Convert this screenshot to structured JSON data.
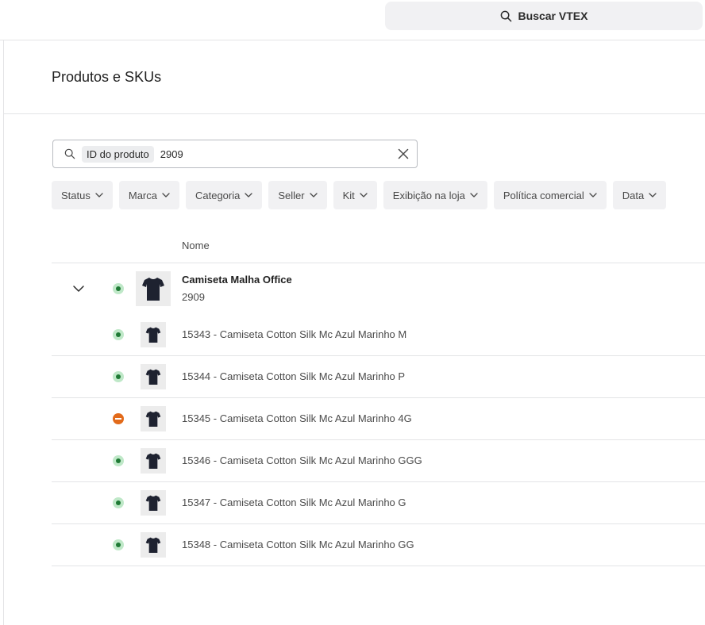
{
  "topbar": {
    "search_label": "Buscar VTEX",
    "search_icon": "search-icon"
  },
  "page": {
    "title": "Produtos e SKUs"
  },
  "filter_input": {
    "chip_label": "ID do produto",
    "value": "2909",
    "clear_icon": "close-icon"
  },
  "filters": [
    "Status",
    "Marca",
    "Categoria",
    "Seller",
    "Kit",
    "Exibição na loja",
    "Política comercial",
    "Data"
  ],
  "table": {
    "column_name": "Nome",
    "product": {
      "name": "Camiseta Malha Office",
      "id": "2909",
      "status": "active",
      "expanded": true
    },
    "skus": [
      {
        "label": "15343 - Camiseta Cotton Silk Mc Azul Marinho M",
        "status": "active"
      },
      {
        "label": "15344 - Camiseta Cotton Silk Mc Azul Marinho P",
        "status": "active"
      },
      {
        "label": "15345 - Camiseta Cotton Silk Mc Azul Marinho 4G",
        "status": "inactive"
      },
      {
        "label": "15346 - Camiseta Cotton Silk Mc Azul Marinho GGG",
        "status": "active"
      },
      {
        "label": "15347 - Camiseta Cotton Silk Mc Azul Marinho G",
        "status": "active"
      },
      {
        "label": "15348 - Camiseta Cotton Silk Mc Azul Marinho GG",
        "status": "active"
      }
    ]
  },
  "colors": {
    "active": "#1f7a35",
    "active_bg": "#bfe8c8",
    "inactive": "#e26a1a",
    "chip_bg": "#f1f1f3",
    "border": "#e3e4e6"
  }
}
